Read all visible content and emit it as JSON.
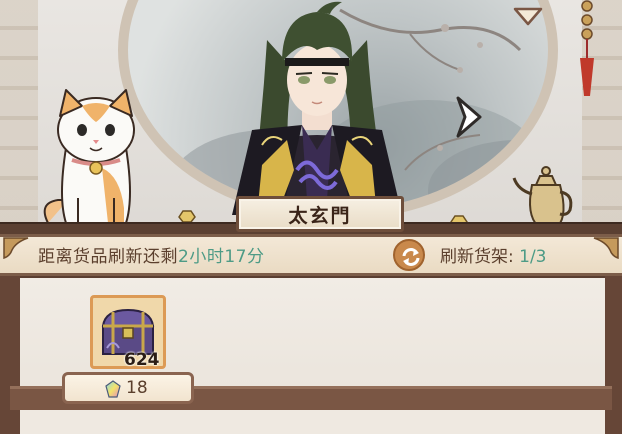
{
  "refresh_bar": {
    "prefix": "距离货品刷新还剩",
    "time_left": "2小时17分",
    "shelf_label": "刷新货架: ",
    "shelf_count": "1/3"
  },
  "merchant": {
    "name": "太玄門"
  },
  "item": {
    "quantity": "624",
    "price": "18",
    "price_currency_icon": "rainbow-gem-icon"
  },
  "colors": {
    "accent_green": "#4d9b86",
    "wood_dark": "#5a3e30",
    "item_border": "#dc9a55"
  }
}
